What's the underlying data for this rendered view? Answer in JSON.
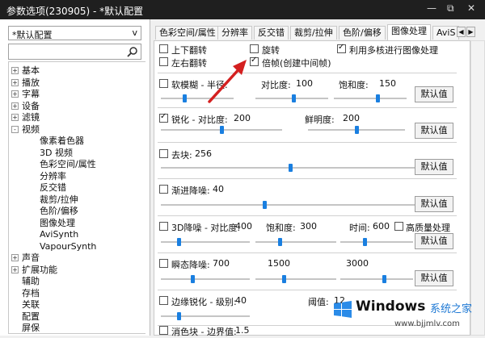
{
  "window": {
    "title": "参数选项(230905) - *默认配置",
    "controls": [
      "—",
      "⧉",
      "✕"
    ]
  },
  "sidebar": {
    "profile": "*默认配置",
    "profile_arrow": "v",
    "search_placeholder": "",
    "tree": [
      {
        "label": "基本",
        "level": 0,
        "expander": "+"
      },
      {
        "label": "播放",
        "level": 0,
        "expander": "+"
      },
      {
        "label": "字幕",
        "level": 0,
        "expander": "+"
      },
      {
        "label": "设备",
        "level": 0,
        "expander": "+"
      },
      {
        "label": "滤镜",
        "level": 0,
        "expander": "+"
      },
      {
        "label": "视频",
        "level": 0,
        "expander": "-"
      },
      {
        "label": "像素着色器",
        "level": 1
      },
      {
        "label": "3D 视频",
        "level": 1
      },
      {
        "label": "色彩空间/属性",
        "level": 1
      },
      {
        "label": "分辨率",
        "level": 1
      },
      {
        "label": "反交错",
        "level": 1
      },
      {
        "label": "裁剪/拉伸",
        "level": 1
      },
      {
        "label": "色阶/偏移",
        "level": 1
      },
      {
        "label": "图像处理",
        "level": 1
      },
      {
        "label": "AviSynth",
        "level": 1
      },
      {
        "label": "VapourSynth",
        "level": 1
      },
      {
        "label": "声音",
        "level": 0,
        "expander": "+"
      },
      {
        "label": "扩展功能",
        "level": 0,
        "expander": "+"
      },
      {
        "label": "辅助",
        "level": 0
      },
      {
        "label": "存档",
        "level": 0
      },
      {
        "label": "关联",
        "level": 0
      },
      {
        "label": "配置",
        "level": 0
      },
      {
        "label": "屏保",
        "level": 0
      }
    ]
  },
  "tabs": [
    {
      "label": "色彩空间/属性",
      "active": false
    },
    {
      "label": "分辨率",
      "active": false
    },
    {
      "label": "反交错",
      "active": false
    },
    {
      "label": "裁剪/拉伸",
      "active": false
    },
    {
      "label": "色阶/偏移",
      "active": false
    },
    {
      "label": "图像处理",
      "active": true
    },
    {
      "label": "AviS",
      "active": false
    }
  ],
  "tab_nav": [
    "◀",
    "▶"
  ],
  "options": {
    "flip_v": {
      "label": "上下翻转",
      "checked": false
    },
    "flip_h": {
      "label": "左右翻转",
      "checked": false
    },
    "rotate": {
      "label": "旋转",
      "checked": false
    },
    "frame_double": {
      "label": "倍帧(创建中间帧)",
      "checked": true
    },
    "multicore": {
      "label": "利用多核进行图像处理",
      "checked": true
    }
  },
  "filters": {
    "soften": {
      "label": "软模糊 - 半径:",
      "checked": false,
      "p2_label": "对比度:",
      "p2_value": "100",
      "p3_label": "饱和度:",
      "p3_value": "150",
      "button": "默认值",
      "s1": 0.32,
      "s2": 0.52,
      "s3": 0.6
    },
    "sharpen": {
      "label": "锐化 - 对比度:",
      "value": "200",
      "checked": true,
      "p2_label": "鲜明度:",
      "p2_value": "200",
      "button": "默认值",
      "s1": 0.5,
      "s2": 0.5
    },
    "deblock": {
      "label": "去块:",
      "value": "256",
      "checked": false,
      "button": "默认值",
      "s1": 0.5
    },
    "denoise": {
      "label": "渐进降噪:",
      "value": "40",
      "checked": false,
      "button": "默认值",
      "s1": 0.4
    },
    "denoise3d": {
      "label": "3D降噪 - 对比度:",
      "value": "400",
      "checked": false,
      "p2_label": "饱和度:",
      "p2_value": "300",
      "p3_label": "时间:",
      "p3_value": "600",
      "hq_label": "高质量处理",
      "hq_checked": false,
      "button": "默认值",
      "s1": 0.2,
      "s2": 0.3,
      "s3": 0.33
    },
    "instant": {
      "label": "瞬态降噪:",
      "value": "700",
      "checked": false,
      "p2_value": "1500",
      "p3_value": "3000",
      "button": "默认值",
      "s1": 0.35,
      "s2": 0.35,
      "s3": 0.6
    },
    "edge": {
      "label": "边缘锐化 - 级别:",
      "value": "40",
      "checked": false,
      "p2_label": "阈值:",
      "p2_value": "12",
      "s1": 0.2
    },
    "deband": {
      "label": "消色块 - 边界值:",
      "value": "1.5",
      "checked": false
    }
  },
  "watermark": {
    "line1": "Windows",
    "line2": "系统之家",
    "line3": "www.bjjmlv.com"
  },
  "colors": {
    "accent": "#1a7fe0",
    "arrow": "#d42020",
    "titlebar": "#1f1f1f"
  }
}
